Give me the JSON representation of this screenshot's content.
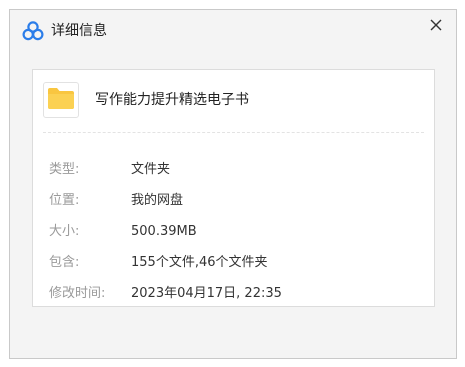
{
  "window": {
    "title": "详细信息",
    "close_label": "✕"
  },
  "file": {
    "name": "写作能力提升精选电子书",
    "icon": "folder-icon",
    "folder_color": "#f9c640"
  },
  "details": [
    {
      "label": "类型:",
      "value": "文件夹"
    },
    {
      "label": "位置:",
      "value": "我的网盘"
    },
    {
      "label": "大小:",
      "value": "500.39MB"
    },
    {
      "label": "包含:",
      "value": "155个文件,46个文件夹"
    },
    {
      "label": "修改时间:",
      "value": "2023年04月17日, 22:35"
    }
  ],
  "colors": {
    "brand": "#2b7de9",
    "label": "#9a9a9a",
    "value": "#333333"
  }
}
